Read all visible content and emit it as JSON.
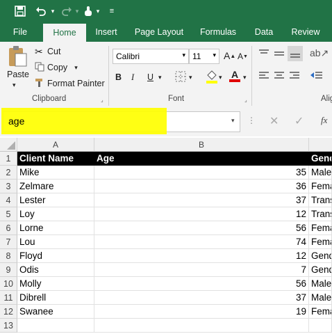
{
  "colors": {
    "brand": "#217346",
    "highlight": "#ffff00",
    "header_fill": "#000000",
    "header_text": "#ffffff"
  },
  "quick_access": [
    "save-icon",
    "undo-icon",
    "redo-icon",
    "touch-mode-icon",
    "customize-icon"
  ],
  "tabs": [
    {
      "label": "File",
      "active": false
    },
    {
      "label": "Home",
      "active": true
    },
    {
      "label": "Insert",
      "active": false
    },
    {
      "label": "Page Layout",
      "active": false
    },
    {
      "label": "Formulas",
      "active": false
    },
    {
      "label": "Data",
      "active": false
    },
    {
      "label": "Review",
      "active": false
    }
  ],
  "clipboard": {
    "paste": "Paste",
    "cut": "Cut",
    "copy": "Copy",
    "format_painter": "Format Painter",
    "group": "Clipboard"
  },
  "font": {
    "name": "Calibri",
    "size": "11",
    "bold": "B",
    "italic": "I",
    "underline": "U",
    "group": "Font"
  },
  "alignment": {
    "group": "Alig"
  },
  "formula_bar": {
    "name_box": "age",
    "fx": "fx"
  },
  "columns": [
    "A",
    "B"
  ],
  "column_c_partial": "",
  "rows": [
    {
      "num": "1",
      "a": "Client Name",
      "b": "Age",
      "c": "Gend"
    },
    {
      "num": "2",
      "a": "Mike",
      "b": "35",
      "c": "Male"
    },
    {
      "num": "3",
      "a": "Zelmare",
      "b": "36",
      "c": "Fema"
    },
    {
      "num": "4",
      "a": "Lester",
      "b": "37",
      "c": "Trans"
    },
    {
      "num": "5",
      "a": "Loy",
      "b": "12",
      "c": "Trans"
    },
    {
      "num": "6",
      "a": "Lorne",
      "b": "56",
      "c": "Fema"
    },
    {
      "num": "7",
      "a": "Lou",
      "b": "74",
      "c": "Fema"
    },
    {
      "num": "8",
      "a": "Floyd",
      "b": "12",
      "c": "Gend"
    },
    {
      "num": "9",
      "a": "Odis",
      "b": "7",
      "c": "Gend"
    },
    {
      "num": "10",
      "a": "Molly",
      "b": "56",
      "c": "Male"
    },
    {
      "num": "11",
      "a": "Dibrell",
      "b": "37",
      "c": "Male"
    },
    {
      "num": "12",
      "a": "Swanee",
      "b": "19",
      "c": "Fema"
    },
    {
      "num": "13",
      "a": "",
      "b": "",
      "c": ""
    }
  ]
}
